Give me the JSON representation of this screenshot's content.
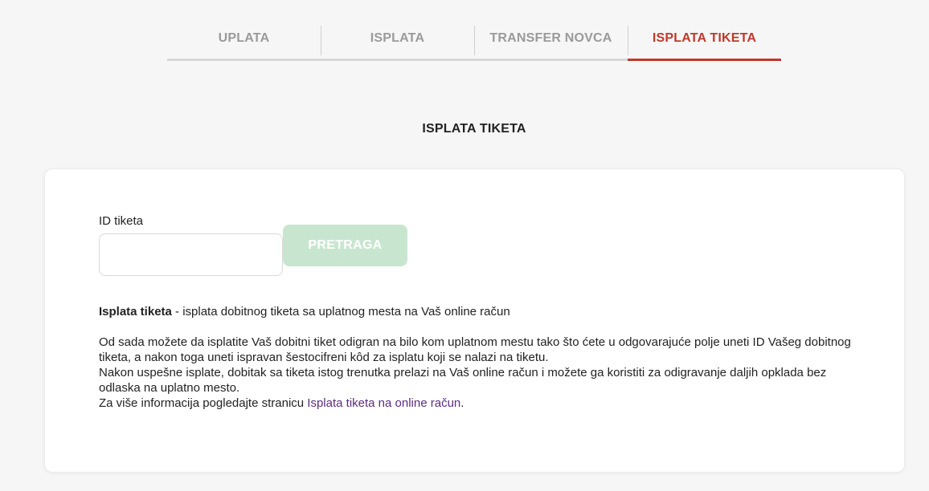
{
  "tabs": [
    {
      "label": "UPLATA",
      "active": false
    },
    {
      "label": "ISPLATA",
      "active": false
    },
    {
      "label": "TRANSFER NOVCA",
      "active": false
    },
    {
      "label": "ISPLATA TIKETA",
      "active": true
    }
  ],
  "page_title": "ISPLATA TIKETA",
  "form": {
    "label": "ID tiketa",
    "value": "",
    "placeholder": "",
    "button_label": "PRETRAGA"
  },
  "info": {
    "lead_bold": "Isplata tiketa",
    "lead_rest": " - isplata dobitnog tiketa sa uplatnog mesta na Vaš online račun",
    "para1": "Od sada možete da isplatite Vaš dobitni tiket odigran na bilo kom uplatnom mestu tako što ćete u odgovarajuće polje uneti ID Vašeg dobitnog tiketa, a nakon toga uneti ispravan šestocifreni kôd za isplatu koji se nalazi na tiketu.",
    "para2": "Nakon uspešne isplate, dobitak sa tiketa istog trenutka prelazi na Vaš online račun i možete ga koristiti za odigravanje daljih opklada bez odlaska na uplatno mesto.",
    "more_prefix": "Za više informacija pogledajte stranicu ",
    "more_link": "Isplata tiketa na online račun",
    "more_suffix": "."
  },
  "colors": {
    "accent": "#c0392b",
    "button_disabled": "#c8e6cf",
    "link": "#5a2d82"
  }
}
